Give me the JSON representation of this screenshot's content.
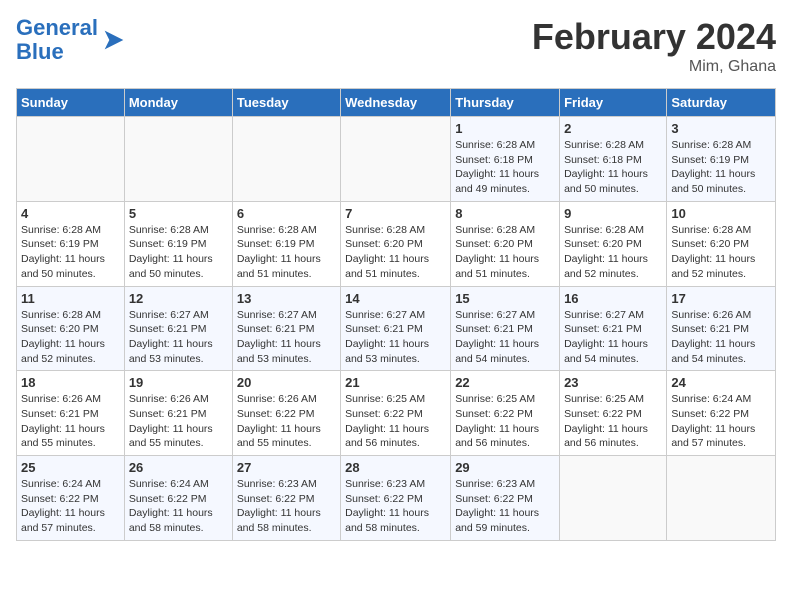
{
  "header": {
    "logo_line1": "General",
    "logo_line2": "Blue",
    "month_year": "February 2024",
    "location": "Mim, Ghana"
  },
  "weekdays": [
    "Sunday",
    "Monday",
    "Tuesday",
    "Wednesday",
    "Thursday",
    "Friday",
    "Saturday"
  ],
  "weeks": [
    [
      {
        "day": "",
        "info": ""
      },
      {
        "day": "",
        "info": ""
      },
      {
        "day": "",
        "info": ""
      },
      {
        "day": "",
        "info": ""
      },
      {
        "day": "1",
        "info": "Sunrise: 6:28 AM\nSunset: 6:18 PM\nDaylight: 11 hours\nand 49 minutes."
      },
      {
        "day": "2",
        "info": "Sunrise: 6:28 AM\nSunset: 6:18 PM\nDaylight: 11 hours\nand 50 minutes."
      },
      {
        "day": "3",
        "info": "Sunrise: 6:28 AM\nSunset: 6:19 PM\nDaylight: 11 hours\nand 50 minutes."
      }
    ],
    [
      {
        "day": "4",
        "info": "Sunrise: 6:28 AM\nSunset: 6:19 PM\nDaylight: 11 hours\nand 50 minutes."
      },
      {
        "day": "5",
        "info": "Sunrise: 6:28 AM\nSunset: 6:19 PM\nDaylight: 11 hours\nand 50 minutes."
      },
      {
        "day": "6",
        "info": "Sunrise: 6:28 AM\nSunset: 6:19 PM\nDaylight: 11 hours\nand 51 minutes."
      },
      {
        "day": "7",
        "info": "Sunrise: 6:28 AM\nSunset: 6:20 PM\nDaylight: 11 hours\nand 51 minutes."
      },
      {
        "day": "8",
        "info": "Sunrise: 6:28 AM\nSunset: 6:20 PM\nDaylight: 11 hours\nand 51 minutes."
      },
      {
        "day": "9",
        "info": "Sunrise: 6:28 AM\nSunset: 6:20 PM\nDaylight: 11 hours\nand 52 minutes."
      },
      {
        "day": "10",
        "info": "Sunrise: 6:28 AM\nSunset: 6:20 PM\nDaylight: 11 hours\nand 52 minutes."
      }
    ],
    [
      {
        "day": "11",
        "info": "Sunrise: 6:28 AM\nSunset: 6:20 PM\nDaylight: 11 hours\nand 52 minutes."
      },
      {
        "day": "12",
        "info": "Sunrise: 6:27 AM\nSunset: 6:21 PM\nDaylight: 11 hours\nand 53 minutes."
      },
      {
        "day": "13",
        "info": "Sunrise: 6:27 AM\nSunset: 6:21 PM\nDaylight: 11 hours\nand 53 minutes."
      },
      {
        "day": "14",
        "info": "Sunrise: 6:27 AM\nSunset: 6:21 PM\nDaylight: 11 hours\nand 53 minutes."
      },
      {
        "day": "15",
        "info": "Sunrise: 6:27 AM\nSunset: 6:21 PM\nDaylight: 11 hours\nand 54 minutes."
      },
      {
        "day": "16",
        "info": "Sunrise: 6:27 AM\nSunset: 6:21 PM\nDaylight: 11 hours\nand 54 minutes."
      },
      {
        "day": "17",
        "info": "Sunrise: 6:26 AM\nSunset: 6:21 PM\nDaylight: 11 hours\nand 54 minutes."
      }
    ],
    [
      {
        "day": "18",
        "info": "Sunrise: 6:26 AM\nSunset: 6:21 PM\nDaylight: 11 hours\nand 55 minutes."
      },
      {
        "day": "19",
        "info": "Sunrise: 6:26 AM\nSunset: 6:21 PM\nDaylight: 11 hours\nand 55 minutes."
      },
      {
        "day": "20",
        "info": "Sunrise: 6:26 AM\nSunset: 6:22 PM\nDaylight: 11 hours\nand 55 minutes."
      },
      {
        "day": "21",
        "info": "Sunrise: 6:25 AM\nSunset: 6:22 PM\nDaylight: 11 hours\nand 56 minutes."
      },
      {
        "day": "22",
        "info": "Sunrise: 6:25 AM\nSunset: 6:22 PM\nDaylight: 11 hours\nand 56 minutes."
      },
      {
        "day": "23",
        "info": "Sunrise: 6:25 AM\nSunset: 6:22 PM\nDaylight: 11 hours\nand 56 minutes."
      },
      {
        "day": "24",
        "info": "Sunrise: 6:24 AM\nSunset: 6:22 PM\nDaylight: 11 hours\nand 57 minutes."
      }
    ],
    [
      {
        "day": "25",
        "info": "Sunrise: 6:24 AM\nSunset: 6:22 PM\nDaylight: 11 hours\nand 57 minutes."
      },
      {
        "day": "26",
        "info": "Sunrise: 6:24 AM\nSunset: 6:22 PM\nDaylight: 11 hours\nand 58 minutes."
      },
      {
        "day": "27",
        "info": "Sunrise: 6:23 AM\nSunset: 6:22 PM\nDaylight: 11 hours\nand 58 minutes."
      },
      {
        "day": "28",
        "info": "Sunrise: 6:23 AM\nSunset: 6:22 PM\nDaylight: 11 hours\nand 58 minutes."
      },
      {
        "day": "29",
        "info": "Sunrise: 6:23 AM\nSunset: 6:22 PM\nDaylight: 11 hours\nand 59 minutes."
      },
      {
        "day": "",
        "info": ""
      },
      {
        "day": "",
        "info": ""
      }
    ]
  ]
}
